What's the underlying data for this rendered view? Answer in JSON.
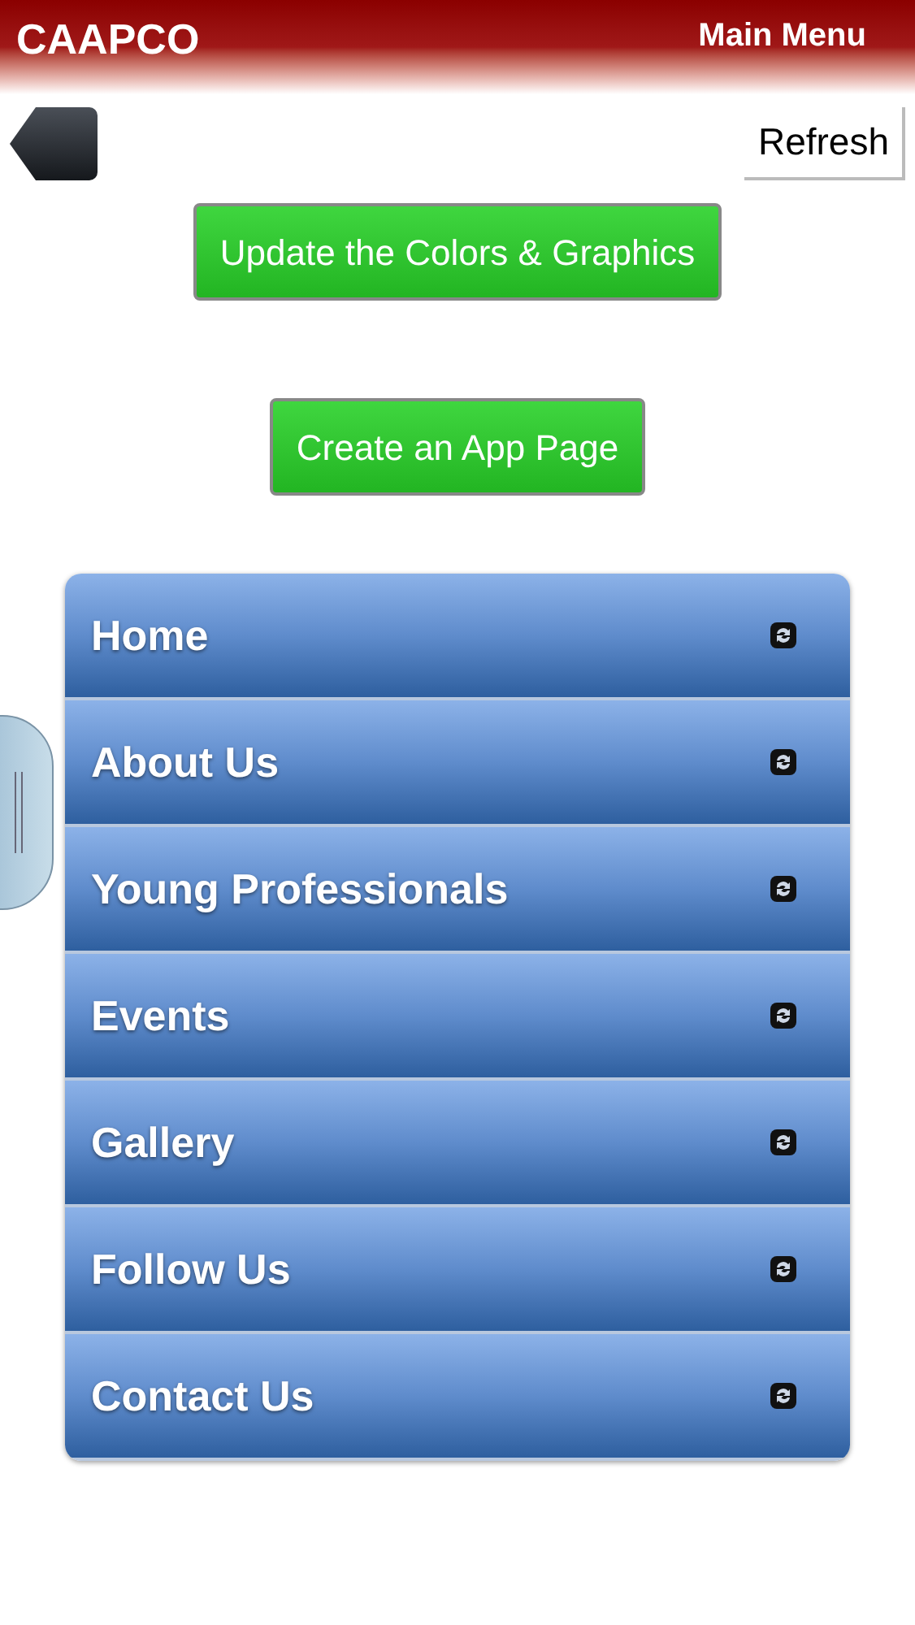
{
  "header": {
    "title": "CAAPCO",
    "menu": "Main Menu"
  },
  "refresh": "Refresh",
  "actions": [
    "Update the Colors & Graphics",
    "Create an App Page"
  ],
  "menu_items": [
    "Home",
    "About Us",
    "Young Professionals",
    "Events",
    "Gallery",
    "Follow Us",
    "Contact Us"
  ]
}
